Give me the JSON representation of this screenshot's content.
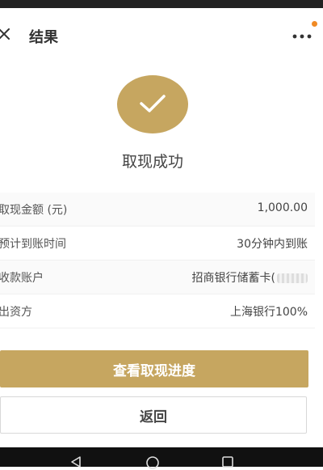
{
  "header": {
    "title": "结果"
  },
  "result": {
    "status_text": "取现成功"
  },
  "details": [
    {
      "label": "取现金额 (元)",
      "value": "1,000.00"
    },
    {
      "label": "预计到账时间",
      "value": "30分钟内到账"
    },
    {
      "label": "收款账户",
      "value": "招商银行储蓄卡("
    },
    {
      "label": "出资方",
      "value": "上海银行100%"
    }
  ],
  "buttons": {
    "primary_label": "查看取现进度",
    "secondary_label": "返回"
  },
  "colors": {
    "accent": "#c6a660",
    "notification": "#f08a24"
  }
}
